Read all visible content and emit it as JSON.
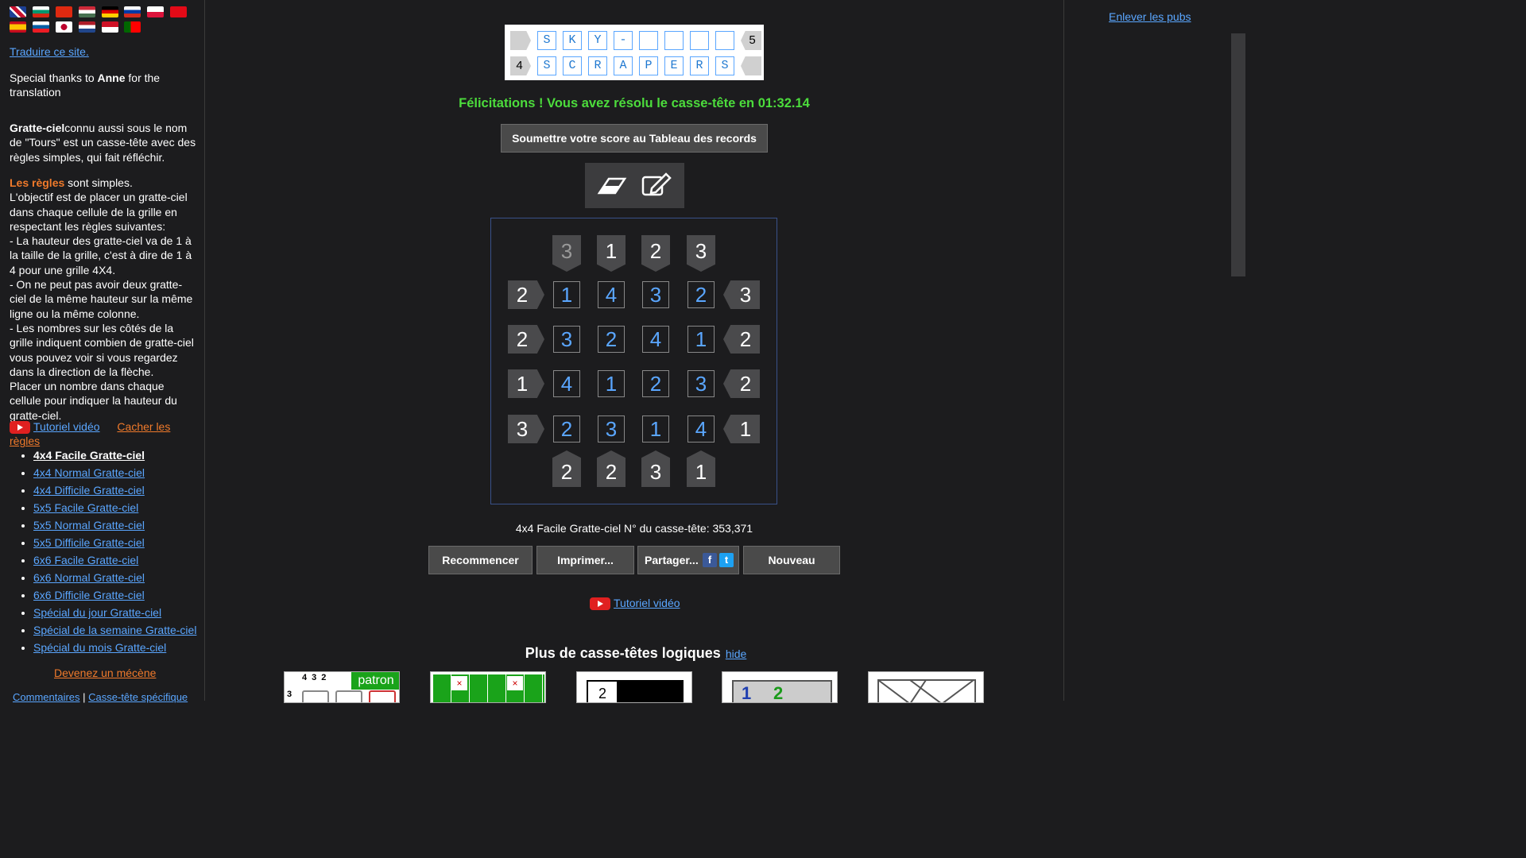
{
  "sidebar": {
    "translate_link": "Traduire ce site.",
    "thanks_prefix": "Special thanks to ",
    "thanks_name": "Anne",
    "thanks_suffix": " for the translation",
    "intro_bold": "Gratte-ciel",
    "intro_text": "connu aussi sous le nom de \"Tours\" est un casse-tête avec des règles simples, qui fait réfléchir.",
    "rules_title": "Les règles",
    "rules_title_suffix": " sont simples.",
    "rules_lines": [
      "L'objectif est de placer un gratte-ciel dans chaque cellule de la grille en respectant les règles suivantes:",
      "- La hauteur des gratte-ciel va de 1 à la taille de la grille, c'est à dire de 1 à 4 pour une grille 4X4.",
      "- On ne peut pas avoir deux gratte-ciel de la même hauteur sur la même ligne ou la même colonne.",
      "- Les nombres sur les côtés de la grille indiquent combien de gratte-ciel vous pouvez voir si vous regardez dans la direction de la flèche.",
      "Placer un nombre dans chaque cellule pour indiquer la hauteur du gratte-ciel."
    ],
    "video_tutorial": "Tutoriel vidéo",
    "hide_rules": "Cacher les règles",
    "puzzles": [
      "4x4 Facile Gratte-ciel",
      "4x4 Normal Gratte-ciel",
      "4x4 Difficile Gratte-ciel",
      "5x5 Facile Gratte-ciel",
      "5x5 Normal Gratte-ciel",
      "5x5 Difficile Gratte-ciel",
      "6x6 Facile Gratte-ciel",
      "6x6 Normal Gratte-ciel",
      "6x6 Difficile Gratte-ciel",
      "Spécial du jour Gratte-ciel",
      "Spécial de la semaine Gratte-ciel",
      "Spécial du mois Gratte-ciel"
    ],
    "patron_link": "Devenez un mécène",
    "footer_link1": "Commentaires",
    "footer_sep": " | ",
    "footer_link2": "Casse-tête spécifique"
  },
  "right": {
    "remove_ads": "Enlever les pubs"
  },
  "title_board": {
    "row1_left_clue": "",
    "row1": [
      "S",
      "K",
      "Y",
      "-",
      "",
      "",
      "",
      ""
    ],
    "row1_right_clue": "5",
    "row2_left_clue": "4",
    "row2": [
      "S",
      "C",
      "R",
      "A",
      "P",
      "E",
      "R",
      "S"
    ],
    "row2_right_clue": ""
  },
  "congrats": "Félicitations ! Vous avez résolu le casse-tête en 01:32.14",
  "submit_button": "Soumettre votre score au Tableau des records",
  "tools": {
    "eraser": "eraser-icon",
    "pencil": "pencil-icon"
  },
  "puzzle": {
    "top": [
      "3",
      "1",
      "2",
      "3"
    ],
    "bottom": [
      "2",
      "2",
      "3",
      "1"
    ],
    "left": [
      "2",
      "2",
      "1",
      "3"
    ],
    "right": [
      "3",
      "2",
      "2",
      "1"
    ],
    "grid": [
      [
        "1",
        "4",
        "3",
        "2"
      ],
      [
        "3",
        "2",
        "4",
        "1"
      ],
      [
        "4",
        "1",
        "2",
        "3"
      ],
      [
        "2",
        "3",
        "1",
        "4"
      ]
    ]
  },
  "puzzle_number_text": "4x4 Facile Gratte-ciel N° du casse-tête: 353,371",
  "buttons": {
    "restart": "Recommencer",
    "print": "Imprimer...",
    "share": "Partager...",
    "new": "Nouveau"
  },
  "share_icons": {
    "facebook": "f",
    "twitter": "t"
  },
  "video_tutorial_main": "Tutoriel vidéo",
  "more_title": "Plus de casse-têtes logiques",
  "more_hide": "hide",
  "thumb1": {
    "badge": "patron",
    "digits": [
      "4",
      "3",
      "2"
    ],
    "side": "3"
  },
  "thumb4": {
    "digits": [
      "1",
      "2"
    ]
  },
  "thumb3": {
    "digit": "2"
  },
  "colors": {
    "background": "#1c1c1e",
    "link": "#5aa6ff",
    "success": "#4cdc3c",
    "accent": "#f07a2b"
  }
}
